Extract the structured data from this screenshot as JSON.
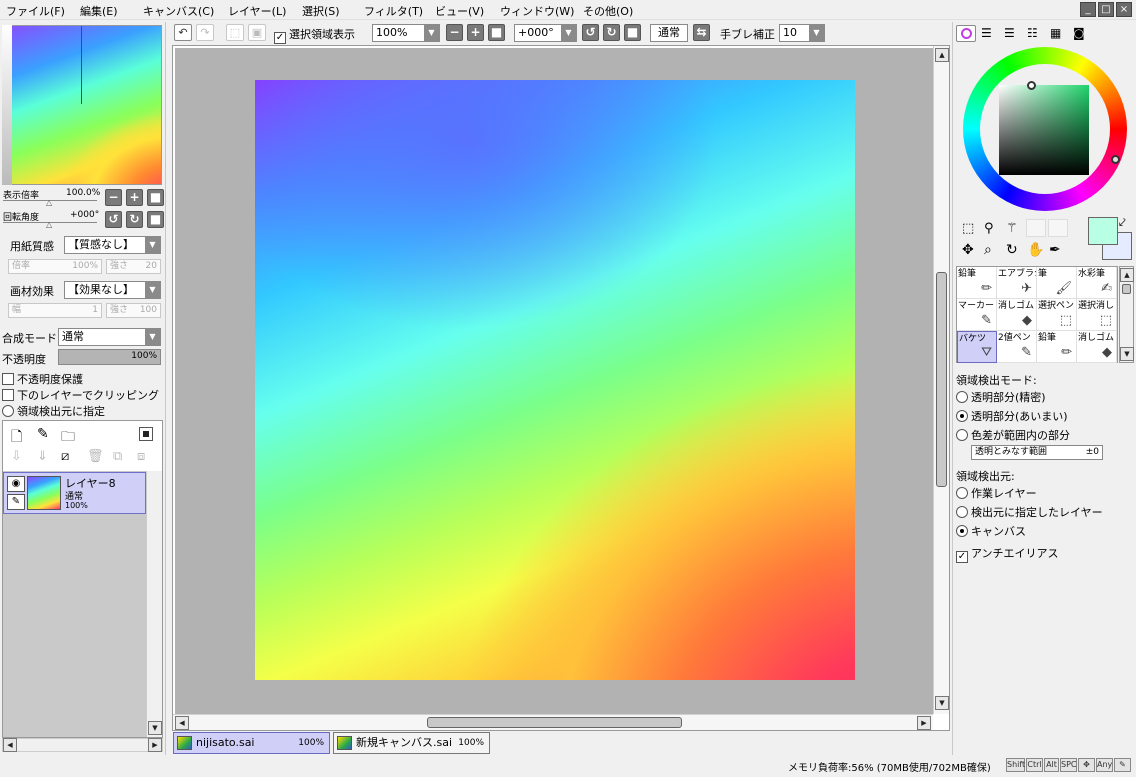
{
  "menu": [
    "ファイル(F)",
    "編集(E)",
    "キャンバス(C)",
    "レイヤー(L)",
    "選択(S)",
    "フィルタ(T)",
    "ビュー(V)",
    "ウィンドウ(W)",
    "その他(O)"
  ],
  "window_buttons": [
    "_",
    "□",
    "×"
  ],
  "toolbar": {
    "selection_display_label": "選択領域表示",
    "zoom_value": "100%",
    "rotation_value": "+000°",
    "mode_value": "通常",
    "stabilizer_label": "手ブレ補正",
    "stabilizer_value": "10"
  },
  "navigator": {
    "zoom_label": "表示倍率",
    "zoom_value": "100.0%",
    "rotation_label": "回転角度",
    "rotation_value": "+000°"
  },
  "paper": {
    "texture_label": "用紙質感",
    "texture_value": "【質感なし】",
    "scale_label": "倍率",
    "scale_value": "100%",
    "strength_label": "強さ",
    "strength_value": "20",
    "effect_label": "画材効果",
    "effect_value": "【効果なし】",
    "width_label": "幅",
    "width_value": "1",
    "effect_strength_label": "強さ",
    "effect_strength_value": "100"
  },
  "layer_props": {
    "blend_label": "合成モード",
    "blend_value": "通常",
    "opacity_label": "不透明度",
    "opacity_value": "100%",
    "opacity_fraction": 1.0,
    "protect_opacity": "不透明度保護",
    "clip_lower": "下のレイヤーでクリッピング",
    "detect_source": "領域検出元に指定"
  },
  "layers": [
    {
      "name": "レイヤー8",
      "mode": "通常",
      "opacity": "100%"
    }
  ],
  "palette_tabs": [
    "color-wheel-icon",
    "list-icon",
    "slider-icon",
    "swatch-list-icon",
    "grid-icon",
    "scratch-icon"
  ],
  "colors": {
    "foreground": "#b8ffe4",
    "background": "#e6ecff",
    "wheel_selection": "#4cd07a"
  },
  "tools": [
    {
      "label": "鉛筆",
      "icon": "pencil-icon"
    },
    {
      "label": "エアブラシ",
      "icon": "airbrush-icon"
    },
    {
      "label": "筆",
      "icon": "brush-icon"
    },
    {
      "label": "水彩筆",
      "icon": "watercolor-icon"
    },
    {
      "label": "マーカー",
      "icon": "marker-icon"
    },
    {
      "label": "消しゴム",
      "icon": "eraser-icon"
    },
    {
      "label": "選択ペン",
      "icon": "select-pen-icon"
    },
    {
      "label": "選択消し",
      "icon": "select-erase-icon"
    },
    {
      "label": "バケツ",
      "icon": "bucket-icon"
    },
    {
      "label": "2値ペン",
      "icon": "binary-pen-icon"
    },
    {
      "label": "鉛筆",
      "icon": "pencil-icon"
    },
    {
      "label": "消しゴム",
      "icon": "eraser-icon"
    }
  ],
  "bucket": {
    "detect_mode_label": "領域検出モード:",
    "mode_options": [
      "透明部分(精密)",
      "透明部分(あいまい)",
      "色差が範囲内の部分"
    ],
    "selected_mode": 1,
    "range_label": "透明とみなす範囲",
    "range_value": "±0",
    "source_label": "領域検出元:",
    "source_options": [
      "作業レイヤー",
      "検出元に指定したレイヤー",
      "キャンバス"
    ],
    "selected_source": 2,
    "antialias_label": "アンチエイリアス"
  },
  "tabs": [
    {
      "name": "nijisato.sai",
      "pct": "100%"
    },
    {
      "name": "新規キャンバス.sai",
      "pct": "100%"
    }
  ],
  "status": {
    "memory": "メモリ負荷率:56% (70MB使用/702MB確保)",
    "keys": [
      "Shift",
      "Ctrl",
      "Alt",
      "SPC",
      "✥",
      "Any",
      "✎"
    ]
  }
}
